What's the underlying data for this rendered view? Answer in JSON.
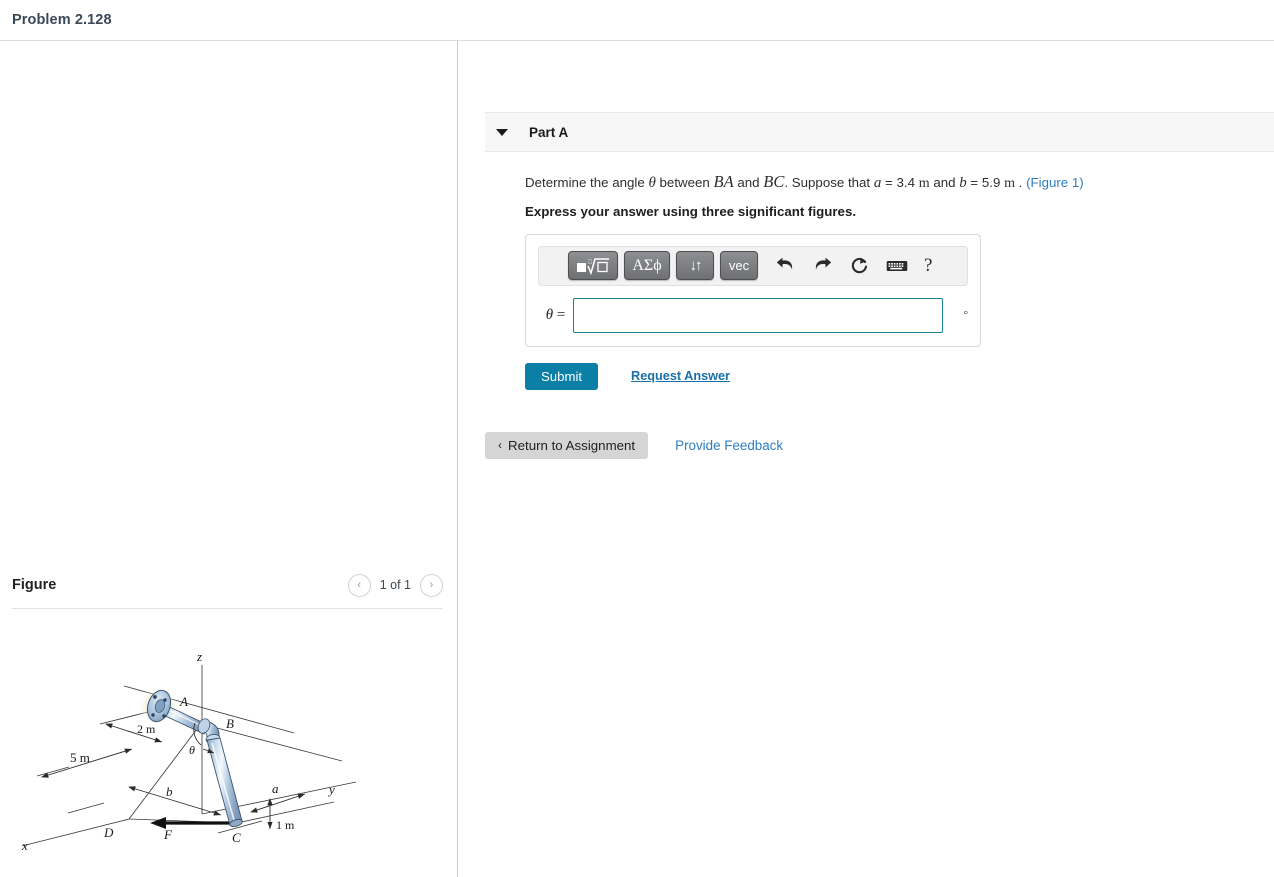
{
  "problem": {
    "title": "Problem 2.128"
  },
  "part": {
    "caret_icon": "triangle-down-icon",
    "title": "Part A",
    "prompt": {
      "lead": "Determine the angle",
      "theta": "θ",
      "between": "between",
      "vector1": "BA",
      "and": "and",
      "vector2": "BC",
      "suppose": ". Suppose that",
      "a_sym": "a",
      "a_eq": "=",
      "a_val": "3.4",
      "a_unit": "m",
      "and2": "and",
      "b_sym": "b",
      "b_eq": "=",
      "b_val": "5.9",
      "b_unit": "m",
      "period": ".",
      "figure_link": "(Figure 1)"
    },
    "express": "Express your answer using three significant figures."
  },
  "toolbar": {
    "buttons": [
      {
        "name": "template-root-button",
        "label": "■√□"
      },
      {
        "name": "greek-symbols-button",
        "label": "ΑΣϕ"
      },
      {
        "name": "updown-arrows-button",
        "label": "↓↑"
      },
      {
        "name": "vector-button",
        "label": "vec"
      }
    ],
    "icons": [
      {
        "name": "undo-icon",
        "glyph": "↶"
      },
      {
        "name": "redo-icon",
        "glyph": "↷"
      },
      {
        "name": "reset-icon",
        "glyph": "↺"
      },
      {
        "name": "keyboard-icon",
        "glyph": "⌨"
      }
    ],
    "help_label": "?"
  },
  "answer": {
    "label_var": "θ",
    "label_eq": "=",
    "value": "",
    "placeholder": "",
    "unit": "°"
  },
  "actions": {
    "submit_label": "Submit",
    "request_answer_label": "Request Answer",
    "return_label": "Return to Assignment",
    "return_chevron": "‹",
    "feedback_label": "Provide Feedback"
  },
  "figure": {
    "heading": "Figure",
    "prev_icon": "chevron-left-icon",
    "next_icon": "chevron-right-icon",
    "prev_glyph": "‹",
    "next_glyph": "›",
    "counter": "1 of 1",
    "diagram": {
      "axis_z": "z",
      "axis_y": "y",
      "axis_x": "x",
      "point_a": "A",
      "point_b": "B",
      "point_c": "C",
      "point_d": "D",
      "force_f": "F",
      "dim_2m": "2 m",
      "dim_5m": "5 m",
      "dim_1m": "1 m",
      "dim_a": "a",
      "dim_b": "b",
      "angle_theta": "θ"
    }
  },
  "colors": {
    "accent_submit": "#0b7fa5",
    "link": "#2e7fc1",
    "input_border": "#1a7f93",
    "pipe_fill": "#a9c3dc",
    "panel_bg": "#f7f7f7"
  }
}
